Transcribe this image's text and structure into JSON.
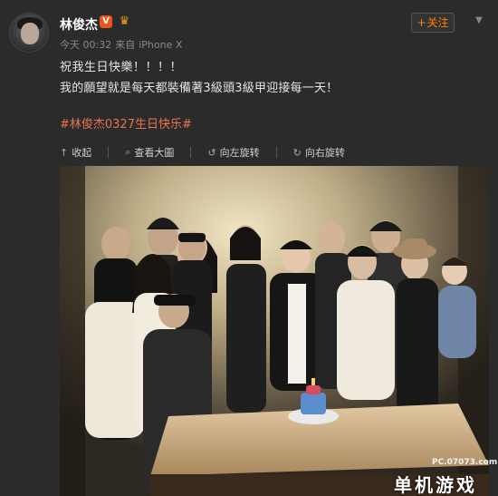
{
  "post": {
    "username": "林俊杰",
    "verified_badge": "V",
    "crown_icon": "crown-icon",
    "meta": {
      "time": "今天 00:32",
      "source_prefix": "来自",
      "source": "iPhone X"
    },
    "follow": {
      "plus": "+",
      "label": "关注"
    },
    "menu_icon": "chevron-down-icon",
    "text_line1": "祝我生日快樂！！！！",
    "text_line2": "我的願望就是每天都裝備著3級頭3級甲迎接每一天！",
    "hashtag": "#林俊杰0327生日快乐#"
  },
  "toolbar": {
    "collapse": {
      "icon": "↑",
      "label": "收起"
    },
    "view_large": {
      "icon": "⌕",
      "label": "查看大圖"
    },
    "rotate_left": {
      "icon": "↺",
      "label": "向左旋转"
    },
    "rotate_right": {
      "icon": "↻",
      "label": "向右旋转"
    }
  },
  "watermark": {
    "domain": "PC.07073.com",
    "logo_text": "单机游戏"
  },
  "colors": {
    "background": "#2b2b2b",
    "accent": "#ff8200",
    "hashtag": "#eb7350",
    "verified": "#e8561e"
  }
}
